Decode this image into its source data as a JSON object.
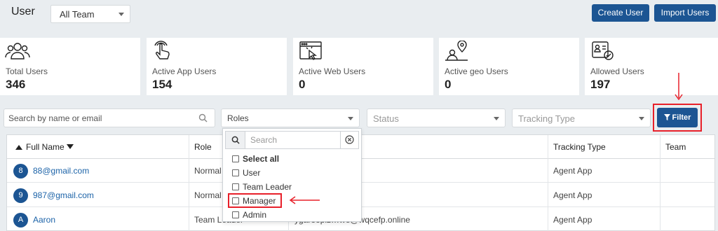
{
  "header": {
    "title": "User",
    "team_select": "All Team",
    "create_user_label": "Create User",
    "import_users_label": "Import Users"
  },
  "stats": [
    {
      "label": "Total Users",
      "value": "346",
      "icon": "users-group-icon"
    },
    {
      "label": "Active App Users",
      "value": "154",
      "icon": "touch-hand-icon"
    },
    {
      "label": "Active Web Users",
      "value": "0",
      "icon": "web-browser-click-icon"
    },
    {
      "label": "Active geo Users",
      "value": "0",
      "icon": "geo-user-pin-icon"
    },
    {
      "label": "Allowed Users",
      "value": "197",
      "icon": "id-card-check-icon"
    }
  ],
  "filters": {
    "search_placeholder": "Search by name or email",
    "roles_label": "Roles",
    "status_placeholder": "Status",
    "tracking_placeholder": "Tracking Type",
    "filter_label": "Filter"
  },
  "table": {
    "headers": {
      "full_name": "Full Name",
      "role": "Role",
      "tracking_type": "Tracking Type",
      "team": "Team"
    },
    "rows": [
      {
        "initial": "8",
        "name": "88@gmail.com",
        "role": "Normal",
        "email": "",
        "tracking": "Agent App"
      },
      {
        "initial": "9",
        "name": "987@gmail.com",
        "role": "Normal",
        "email": "",
        "tracking": "Agent App"
      },
      {
        "initial": "A",
        "name": "Aaron",
        "role": "Team Leader",
        "email": "ygaroopiz…we@wqcefp.online",
        "tracking": "Agent App"
      }
    ]
  },
  "roles_dropdown": {
    "search_placeholder": "Search",
    "select_all": "Select all",
    "options": [
      "User",
      "Team Leader",
      "Manager",
      "Admin"
    ]
  },
  "colors": {
    "primary": "#1c5593",
    "highlight": "#e8202a",
    "background": "#e9edf0"
  }
}
